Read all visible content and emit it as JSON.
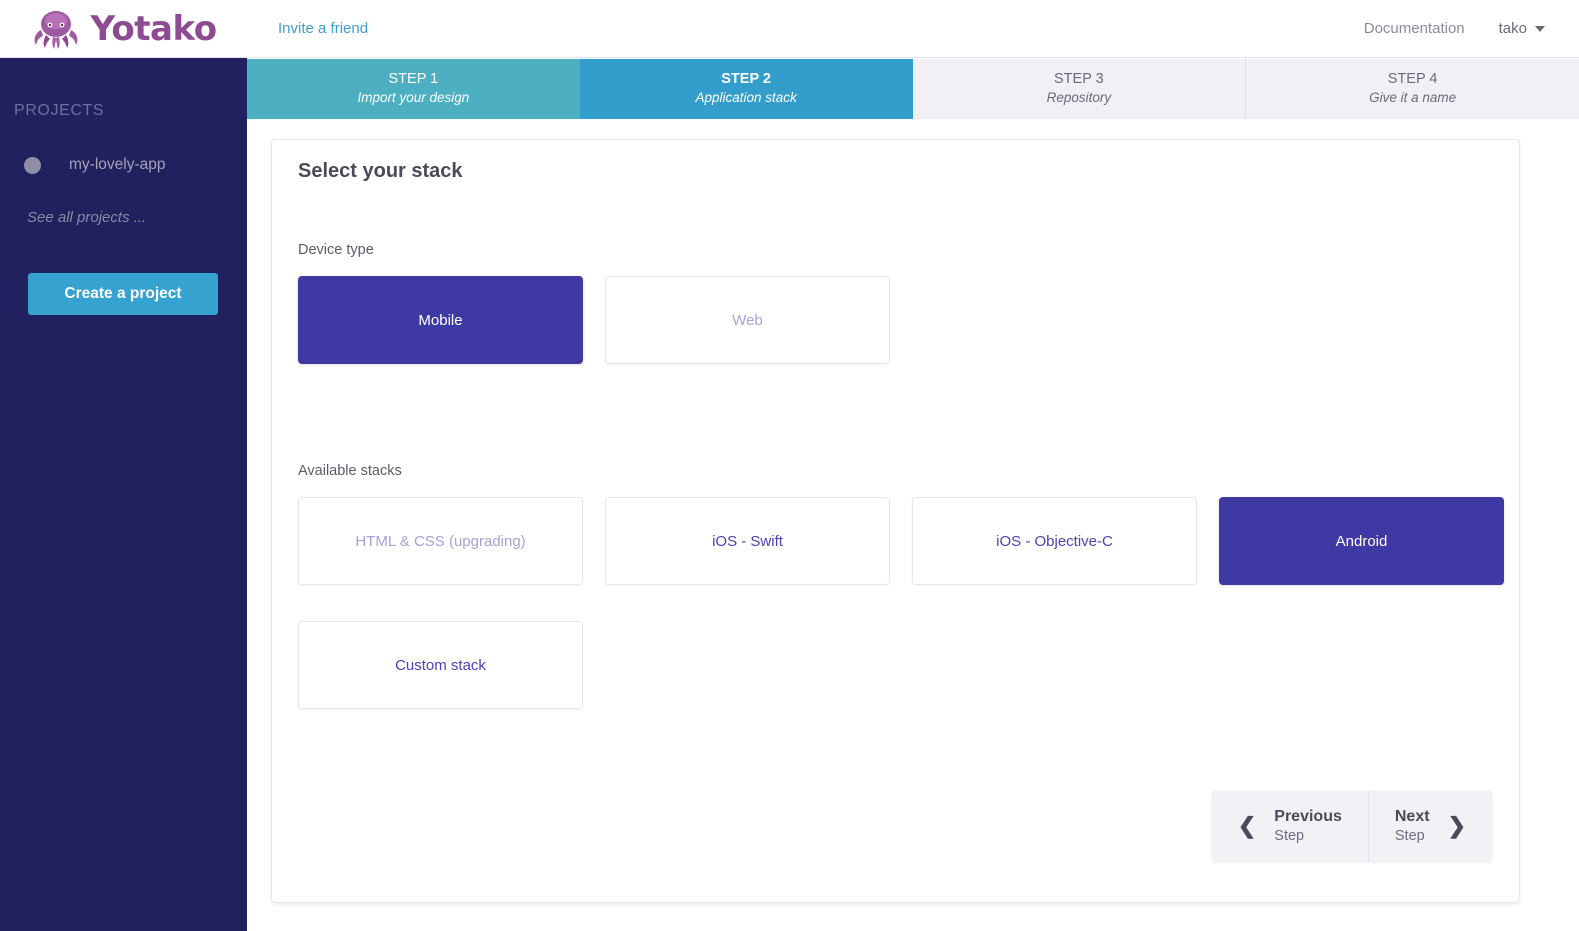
{
  "brand": {
    "name": "Yotako",
    "logo_icon": "octopus-icon",
    "logo_color": "#8e4a93"
  },
  "topbar": {
    "invite_label": "Invite a friend",
    "documentation_label": "Documentation",
    "user_label": "tako",
    "caret_icon": "chevron-down-icon"
  },
  "sidebar": {
    "section_title": "PROJECTS",
    "projects": [
      {
        "name": "my-lovely-app",
        "dot_color": "#8e8ea4"
      }
    ],
    "see_all_label": "See all projects ...",
    "create_label": "Create a project",
    "background_color": "#20215e",
    "create_color": "#36a2d0"
  },
  "steps": [
    {
      "number": "STEP 1",
      "label": "Import your design",
      "state": "done",
      "color": "#4db0c2"
    },
    {
      "number": "STEP 2",
      "label": "Application stack",
      "state": "active",
      "color": "#339ecb"
    },
    {
      "number": "STEP 3",
      "label": "Repository",
      "state": "todo",
      "color": "#f2eff5"
    },
    {
      "number": "STEP 4",
      "label": "Give it a name",
      "state": "todo",
      "color": "#f2eff5"
    }
  ],
  "main": {
    "title": "Select your stack",
    "device_type": {
      "label": "Device type",
      "options": [
        {
          "label": "Mobile",
          "state": "selected"
        },
        {
          "label": "Web",
          "state": "disabled"
        }
      ]
    },
    "available_stacks": {
      "label": "Available stacks",
      "row1": [
        {
          "label": "HTML & CSS (upgrading)",
          "state": "disabled"
        },
        {
          "label": "iOS - Swift",
          "state": "default"
        },
        {
          "label": "iOS - Objective-C",
          "state": "default"
        },
        {
          "label": "Android",
          "state": "selected"
        }
      ],
      "row2": [
        {
          "label": "Custom stack",
          "state": "default"
        }
      ]
    },
    "selected_color": "#3f39a3"
  },
  "nav": {
    "previous": {
      "main": "Previous",
      "sub": "Step",
      "icon": "chevron-left-icon"
    },
    "next": {
      "main": "Next",
      "sub": "Step",
      "icon": "chevron-right-icon"
    }
  }
}
